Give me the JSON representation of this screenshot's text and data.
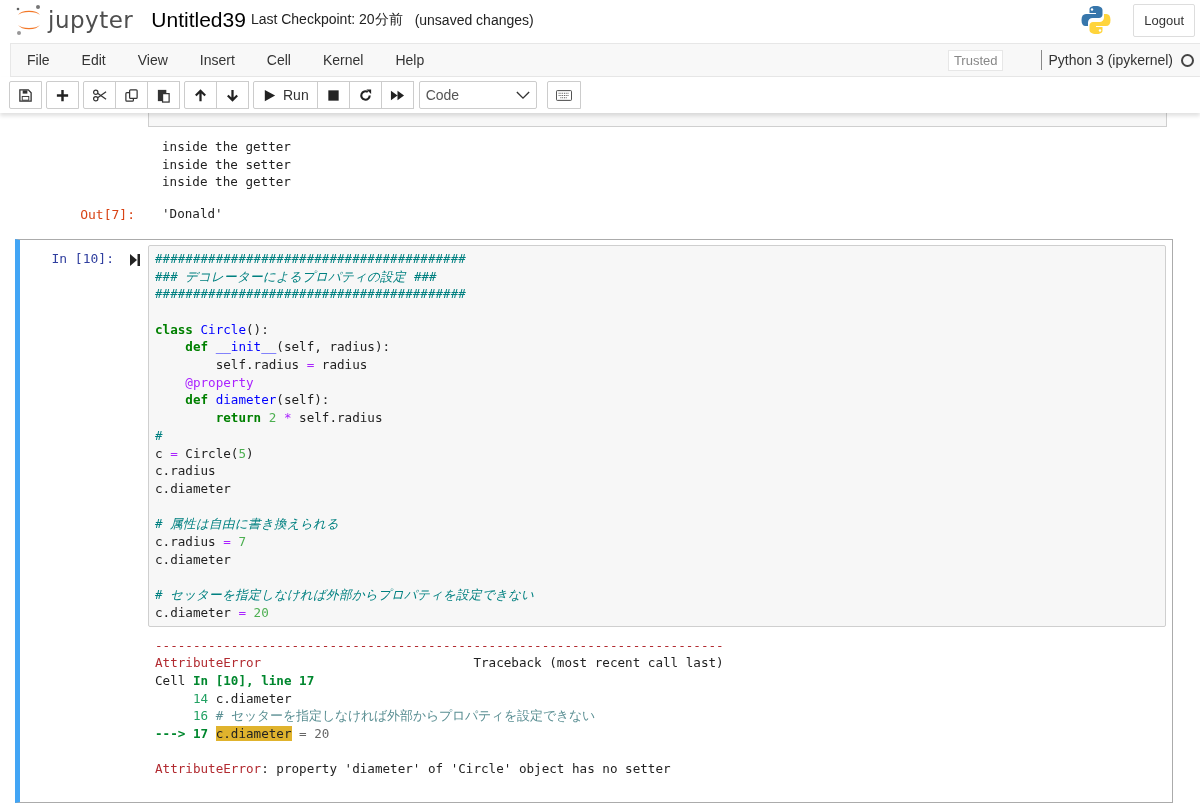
{
  "header": {
    "logo_text": "jupyter",
    "notebook_name": "Untitled39",
    "checkpoint": "Last Checkpoint: 20分前",
    "save_status": "(unsaved changes)",
    "logout": "Logout"
  },
  "menubar": {
    "items": [
      "File",
      "Edit",
      "View",
      "Insert",
      "Cell",
      "Kernel",
      "Help"
    ],
    "trusted": "Trusted",
    "kernel_name": "Python 3 (ipykernel)",
    "kernel_busy": false
  },
  "toolbar": {
    "groups": [
      {
        "buttons": [
          {
            "kind": "save"
          }
        ]
      },
      {
        "buttons": [
          {
            "kind": "add"
          }
        ]
      },
      {
        "buttons": [
          {
            "kind": "cut"
          },
          {
            "kind": "copy"
          },
          {
            "kind": "paste"
          }
        ]
      },
      {
        "buttons": [
          {
            "kind": "up"
          },
          {
            "kind": "down"
          }
        ]
      },
      {
        "buttons": [
          {
            "kind": "run",
            "label": "Run"
          },
          {
            "kind": "stop"
          },
          {
            "kind": "restart"
          },
          {
            "kind": "fastforward"
          }
        ]
      }
    ],
    "cell_type": "Code"
  },
  "cells": [
    {
      "selected": false,
      "outputs": [
        {
          "kind": "stream",
          "lines": [
            "inside the getter",
            "inside the setter",
            "inside the getter"
          ]
        },
        {
          "kind": "result",
          "prompt": "Out[7]:",
          "text": "'Donald'"
        }
      ]
    },
    {
      "selected": true,
      "prompt": "In [10]:",
      "code": [
        {
          "kind": "code",
          "tokens": [
            {
              "kind": "comment",
              "text": "#########################################"
            }
          ]
        },
        {
          "kind": "code",
          "tokens": [
            {
              "kind": "comment",
              "text": "### デコレーターによるプロパティの設定 ###"
            }
          ]
        },
        {
          "kind": "code",
          "tokens": [
            {
              "kind": "comment",
              "text": "#########################################"
            }
          ]
        },
        {
          "kind": "blank"
        },
        {
          "kind": "code",
          "tokens": [
            {
              "kind": "kw",
              "text": "class"
            },
            {
              "kind": "name",
              "text": " Circle"
            },
            {
              "kind": "plain",
              "text": "():"
            }
          ]
        },
        {
          "kind": "code",
          "tokens": [
            {
              "kind": "kw",
              "text": "    def"
            },
            {
              "kind": "name",
              "text": " __init__"
            },
            {
              "kind": "plain",
              "text": "(self, radius):"
            }
          ]
        },
        {
          "kind": "code",
          "tokens": [
            {
              "kind": "plain",
              "text": "        self.radius"
            },
            {
              "kind": "op",
              "text": " ="
            },
            {
              "kind": "plain",
              "text": " radius"
            }
          ]
        },
        {
          "kind": "code",
          "tokens": [
            {
              "kind": "deco",
              "text": "    @property"
            }
          ]
        },
        {
          "kind": "code",
          "tokens": [
            {
              "kind": "kw",
              "text": "    def"
            },
            {
              "kind": "name",
              "text": " diameter"
            },
            {
              "kind": "plain",
              "text": "(self):"
            }
          ]
        },
        {
          "kind": "code",
          "tokens": [
            {
              "kind": "kw",
              "text": "        return"
            },
            {
              "kind": "num",
              "text": " 2"
            },
            {
              "kind": "op",
              "text": " *"
            },
            {
              "kind": "plain",
              "text": " self.radius"
            }
          ]
        },
        {
          "kind": "code",
          "tokens": [
            {
              "kind": "comment",
              "text": "#"
            }
          ]
        },
        {
          "kind": "code",
          "tokens": [
            {
              "kind": "plain",
              "text": "c"
            },
            {
              "kind": "op",
              "text": " ="
            },
            {
              "kind": "plain",
              "text": " Circle("
            },
            {
              "kind": "num",
              "text": "5"
            },
            {
              "kind": "plain",
              "text": ")"
            }
          ]
        },
        {
          "kind": "code",
          "tokens": [
            {
              "kind": "plain",
              "text": "c.radius"
            }
          ]
        },
        {
          "kind": "code",
          "tokens": [
            {
              "kind": "plain",
              "text": "c.diameter"
            }
          ]
        },
        {
          "kind": "blank"
        },
        {
          "kind": "code",
          "tokens": [
            {
              "kind": "comment",
              "text": "# 属性は自由に書き換えられる"
            }
          ]
        },
        {
          "kind": "code",
          "tokens": [
            {
              "kind": "plain",
              "text": "c.radius"
            },
            {
              "kind": "op",
              "text": " ="
            },
            {
              "kind": "num",
              "text": " 7"
            }
          ]
        },
        {
          "kind": "code",
          "tokens": [
            {
              "kind": "plain",
              "text": "c.diameter"
            }
          ]
        },
        {
          "kind": "blank"
        },
        {
          "kind": "code",
          "tokens": [
            {
              "kind": "comment",
              "text": "# セッターを指定しなければ外部からプロパティを設定できない"
            }
          ]
        },
        {
          "kind": "code",
          "tokens": [
            {
              "kind": "plain",
              "text": "c.diameter"
            },
            {
              "kind": "op",
              "text": " ="
            },
            {
              "kind": "num",
              "text": " 20"
            }
          ]
        }
      ],
      "outputs": [
        {
          "kind": "error",
          "lines": [
            {
              "kind": "code",
              "tokens": [
                {
                  "kind": "err",
                  "text": "---------------------------------------------------------------------------"
                }
              ]
            },
            {
              "kind": "code",
              "tokens": [
                {
                  "kind": "err",
                  "text": "AttributeError"
                },
                {
                  "kind": "plain",
                  "text": "                            Traceback (most recent call last)"
                }
              ]
            },
            {
              "kind": "code",
              "tokens": [
                {
                  "kind": "plain",
                  "text": "Cell"
                },
                {
                  "kind": "loc",
                  "text": " In [10], line 17"
                }
              ]
            },
            {
              "kind": "code",
              "tokens": [
                {
                  "kind": "lineno",
                  "text": "     14"
                },
                {
                  "kind": "plain",
                  "text": " c.diameter"
                }
              ]
            },
            {
              "kind": "code",
              "tokens": [
                {
                  "kind": "lineno",
                  "text": "     16"
                },
                {
                  "kind": "tbcomment",
                  "text": " # セッターを指定しなければ外部からプロパティを設定できない"
                }
              ]
            },
            {
              "kind": "code",
              "tokens": [
                {
                  "kind": "loc",
                  "text": "---> 17 "
                },
                {
                  "kind": "hl",
                  "text": "c.diameter"
                },
                {
                  "kind": "dim",
                  "text": " = 20"
                }
              ]
            },
            {
              "kind": "blank"
            },
            {
              "kind": "code",
              "tokens": [
                {
                  "kind": "err",
                  "text": "AttributeError"
                },
                {
                  "kind": "plain",
                  "text": ": property 'diameter' of 'Circle' object has no setter"
                }
              ]
            }
          ]
        }
      ]
    }
  ]
}
